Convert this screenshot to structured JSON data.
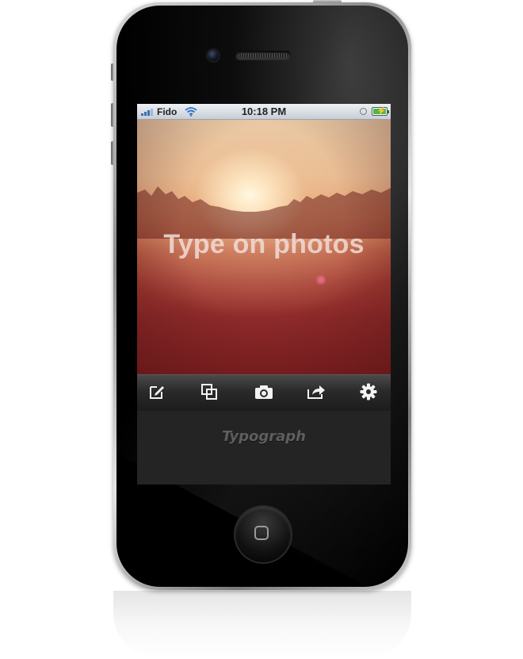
{
  "status_bar": {
    "carrier": "Fido",
    "time": "10:18 PM",
    "battery_level": 1.0,
    "charging": true
  },
  "photo": {
    "caption": "Type on photos"
  },
  "toolbar": {
    "buttons": [
      {
        "icon": "edit-icon"
      },
      {
        "icon": "layers-icon"
      },
      {
        "icon": "camera-icon"
      },
      {
        "icon": "share-icon"
      },
      {
        "icon": "gear-icon"
      }
    ]
  },
  "brand": {
    "name": "Typograph"
  },
  "colors": {
    "toolbar": "#2a2a2a",
    "brand_text": "#5e5e5e",
    "caption_text": "#eedad4"
  }
}
